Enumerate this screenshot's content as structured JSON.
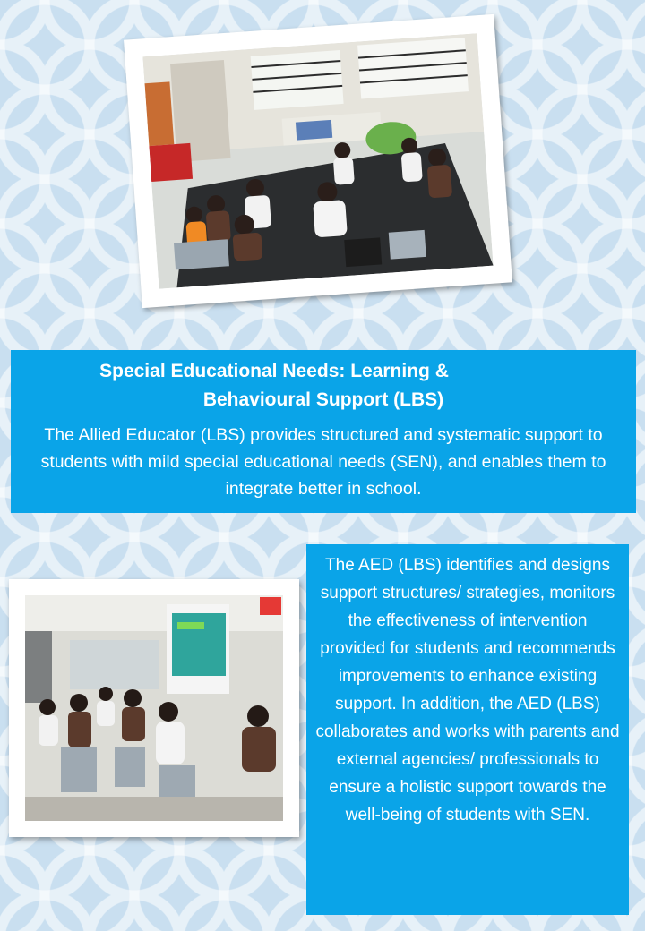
{
  "top_photo": {
    "description_icon": "photo-students-sitting-in-circle"
  },
  "bottom_photo": {
    "description_icon": "photo-students-in-classroom-presentation"
  },
  "banner": {
    "title_line1": "Special Educational Needs: Learning &",
    "title_line2": "Behavioural Support (LBS)",
    "body": "The Allied Educator (LBS) provides structured and systematic support to students with mild special educational needs (SEN), and enables them to integrate better in school."
  },
  "side_box": {
    "body": "The AED (LBS) identifies and designs support structures/ strategies, monitors the effectiveness of intervention provided for students and recommends improvements to enhance existing support. In addition, the AED (LBS) collaborates and works with parents and external agencies/ professionals to ensure a holistic support towards the well-being of students with SEN."
  },
  "colors": {
    "accent_blue": "#0aa4e8",
    "background": "#c9dff0"
  }
}
